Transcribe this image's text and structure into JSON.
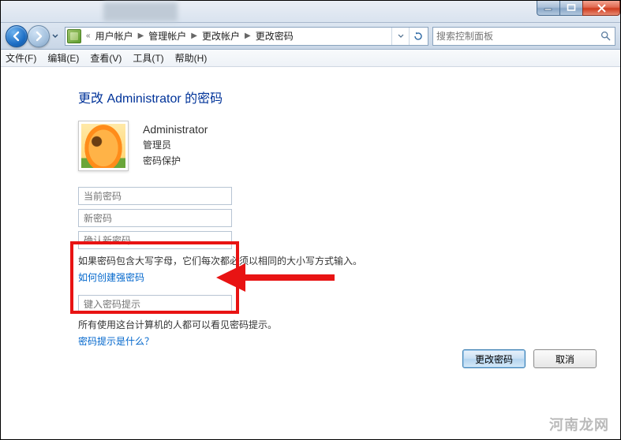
{
  "window": {
    "min_icon": "minimize",
    "max_icon": "maximize",
    "close_icon": "close"
  },
  "breadcrumb": {
    "items": [
      "用户帐户",
      "管理帐户",
      "更改帐户",
      "更改密码"
    ]
  },
  "search": {
    "placeholder": "搜索控制面板"
  },
  "menu": {
    "file": "文件(F)",
    "edit": "编辑(E)",
    "view": "查看(V)",
    "tools": "工具(T)",
    "help": "帮助(H)"
  },
  "page": {
    "title": "更改 Administrator 的密码",
    "user": {
      "name": "Administrator",
      "role": "管理员",
      "protection": "密码保护"
    },
    "fields": {
      "current_pw_ph": "当前密码",
      "new_pw_ph": "新密码",
      "confirm_pw_ph": "确认新密码",
      "hint_ph": "键入密码提示"
    },
    "case_hint": "如果密码包含大写字母，它们每次都必须以相同的大小写方式输入。",
    "strong_link": "如何创建强密码",
    "hint_visible": "所有使用这台计算机的人都可以看见密码提示。",
    "hint_link": "密码提示是什么？",
    "btn_ok": "更改密码",
    "btn_cancel": "取消"
  },
  "watermark": "河南龙网"
}
